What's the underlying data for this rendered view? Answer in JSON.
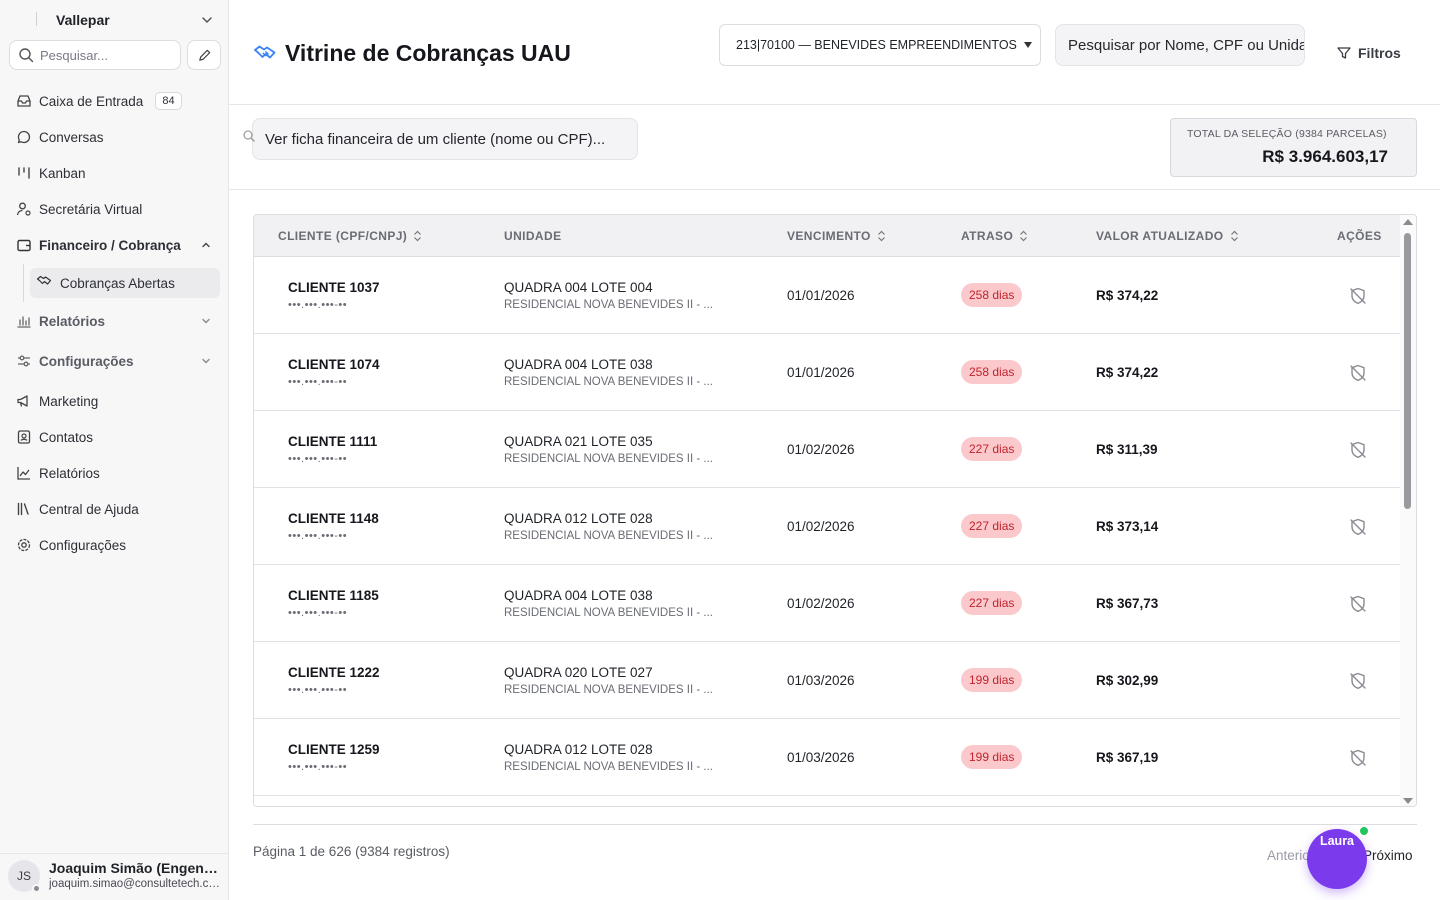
{
  "sidebar": {
    "org_name": "Vallepar",
    "search_placeholder": "Pesquisar...",
    "items": [
      {
        "label": "Caixa de Entrada",
        "icon": "inbox-icon",
        "badge": "84"
      },
      {
        "label": "Conversas",
        "icon": "chat-bubble-icon"
      },
      {
        "label": "Kanban",
        "icon": "kanban-icon"
      },
      {
        "label": "Secretária Virtual",
        "icon": "user-gear-icon"
      },
      {
        "label": "Financeiro / Cobrança",
        "icon": "wallet-icon"
      },
      {
        "label": "Relatórios",
        "icon": "bar-chart-icon"
      },
      {
        "label": "Configurações",
        "icon": "sliders-icon"
      },
      {
        "label": "Marketing",
        "icon": "megaphone-icon"
      },
      {
        "label": "Contatos",
        "icon": "contact-card-icon"
      },
      {
        "label": "Relatórios",
        "icon": "line-chart-icon"
      },
      {
        "label": "Central de Ajuda",
        "icon": "books-icon"
      },
      {
        "label": "Configurações",
        "icon": "gear-icon"
      }
    ],
    "sub_item": "Cobranças Abertas",
    "user": {
      "initials": "JS",
      "name": "Joaquim Simão (Engenharia)",
      "email": "joaquim.simao@consultetech.com.br"
    }
  },
  "header": {
    "title": "Vitrine de Cobranças UAU",
    "company_select": "213|70100 — BENEVIDES EMPREENDIMENTOS",
    "search_placeholder": "Pesquisar por Nome, CPF ou Unidade",
    "filters_label": "Filtros"
  },
  "subbar": {
    "client_search_placeholder": "Ver ficha financeira de um cliente (nome ou CPF)...",
    "total_label": "TOTAL DA SELEÇÃO (9384 PARCELAS)",
    "total_value": "R$ 3.964.603,17"
  },
  "table": {
    "columns": [
      "CLIENTE (CPF/CNPJ)",
      "UNIDADE",
      "VENCIMENTO",
      "ATRASO",
      "VALOR ATUALIZADO",
      "AÇÕES"
    ],
    "rows": [
      {
        "client": "CLIENTE 1037",
        "doc": "•••.•••.•••-••",
        "unit": "QUADRA 004 LOTE 004",
        "project": "RESIDENCIAL NOVA BENEVIDES II - ...",
        "due": "01/01/2026",
        "late": "258 dias",
        "value": "R$ 374,22"
      },
      {
        "client": "CLIENTE 1074",
        "doc": "•••.•••.•••-••",
        "unit": "QUADRA 004 LOTE 038",
        "project": "RESIDENCIAL NOVA BENEVIDES II - ...",
        "due": "01/01/2026",
        "late": "258 dias",
        "value": "R$ 374,22"
      },
      {
        "client": "CLIENTE 1111",
        "doc": "•••.•••.•••-••",
        "unit": "QUADRA 021 LOTE 035",
        "project": "RESIDENCIAL NOVA BENEVIDES II - ...",
        "due": "01/02/2026",
        "late": "227 dias",
        "value": "R$ 311,39"
      },
      {
        "client": "CLIENTE 1148",
        "doc": "•••.•••.•••-••",
        "unit": "QUADRA 012 LOTE 028",
        "project": "RESIDENCIAL NOVA BENEVIDES II - ...",
        "due": "01/02/2026",
        "late": "227 dias",
        "value": "R$ 373,14"
      },
      {
        "client": "CLIENTE 1185",
        "doc": "•••.•••.•••-••",
        "unit": "QUADRA 004 LOTE 038",
        "project": "RESIDENCIAL NOVA BENEVIDES II - ...",
        "due": "01/02/2026",
        "late": "227 dias",
        "value": "R$ 367,73"
      },
      {
        "client": "CLIENTE 1222",
        "doc": "•••.•••.•••-••",
        "unit": "QUADRA 020 LOTE 027",
        "project": "RESIDENCIAL NOVA BENEVIDES II - ...",
        "due": "01/03/2026",
        "late": "199 dias",
        "value": "R$ 302,99"
      },
      {
        "client": "CLIENTE 1259",
        "doc": "•••.•••.•••-••",
        "unit": "QUADRA 012 LOTE 028",
        "project": "RESIDENCIAL NOVA BENEVIDES II - ...",
        "due": "01/03/2026",
        "late": "199 dias",
        "value": "R$ 367,19"
      }
    ]
  },
  "pager": {
    "text": "Página 1 de 626 (9384 registros)",
    "prev": "Anterior",
    "next": "Próximo"
  },
  "assistant": {
    "label": "Laura"
  },
  "colors": {
    "accent": "#3b82f6",
    "late_bg": "#fbc9cc",
    "late_text": "#c1232d",
    "assistant": "#7c3aed",
    "online": "#22c55e"
  }
}
